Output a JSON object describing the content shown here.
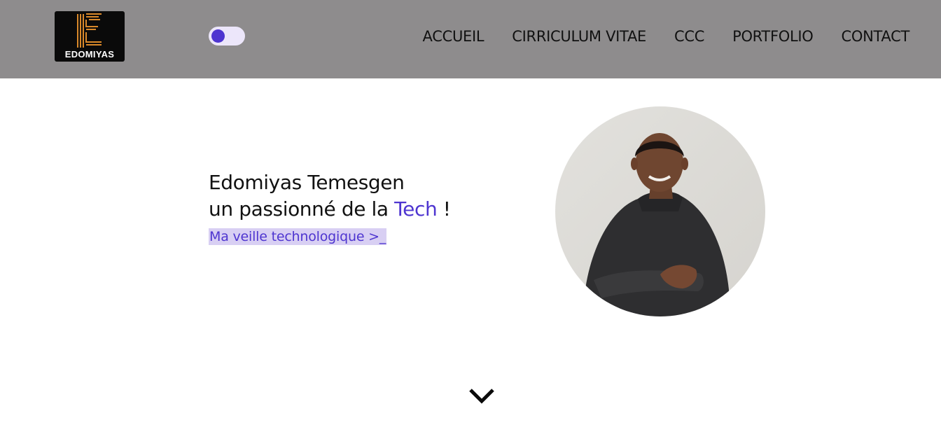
{
  "header": {
    "logo": {
      "text": "EDOMIYAS",
      "icon": "e-letter-logo-icon",
      "colors": {
        "background": "#0a0a0a",
        "stripes": "#d9892a"
      }
    },
    "theme_toggle": {
      "state": "off",
      "knob_color": "#4e35d0"
    },
    "nav": [
      "ACCUEIL",
      "CIRRICULUM VITAE",
      "CCC",
      "PORTFOLIO",
      "CONTACT"
    ],
    "background": "#8e8c8d"
  },
  "hero": {
    "name_line": "Edomiyas Temesgen",
    "tagline_prefix": "un passionné de la ",
    "tagline_accent": "Tech",
    "tagline_suffix": " !",
    "veille_link": "Ma veille technologique >_",
    "photo": "profile-photo",
    "accent_color": "#4e35d0"
  },
  "scroll_indicator": {
    "icon": "chevron-down-icon"
  }
}
